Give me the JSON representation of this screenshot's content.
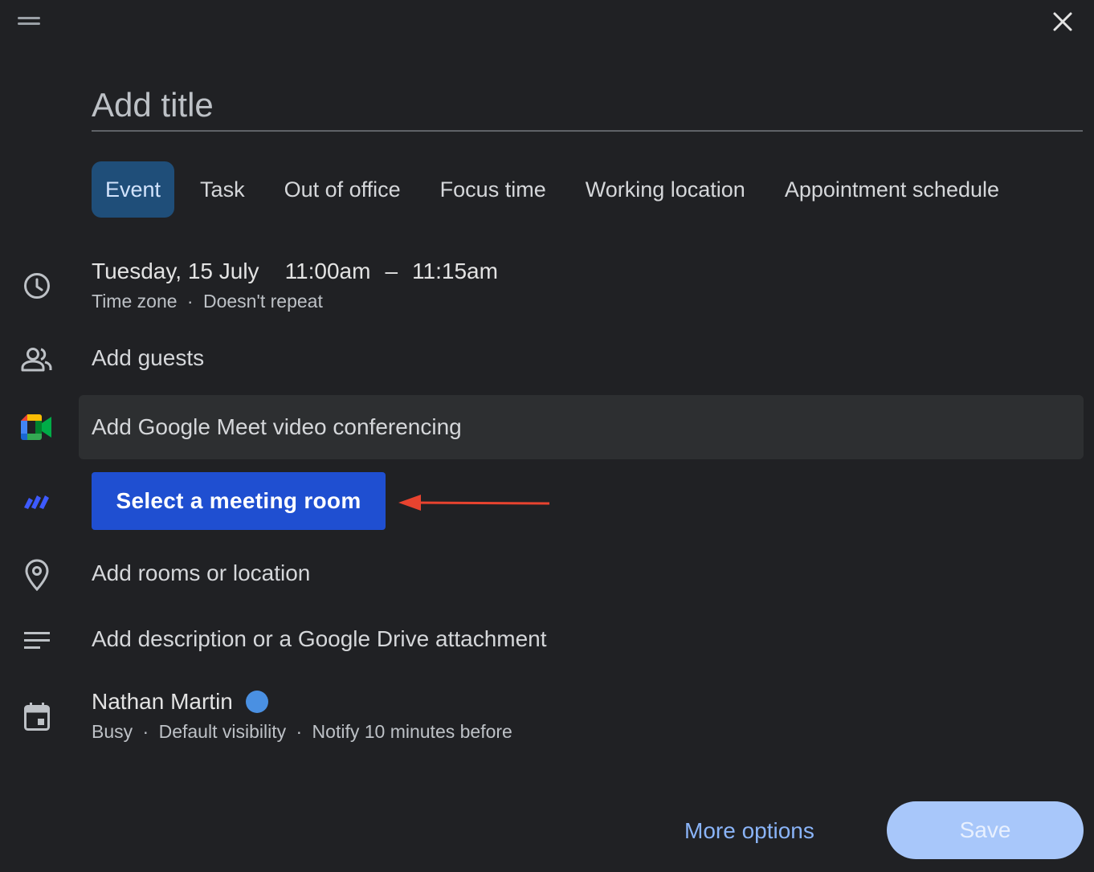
{
  "dialog": {
    "title_placeholder": "Add title",
    "tabs": [
      {
        "label": "Event",
        "active": true
      },
      {
        "label": "Task",
        "active": false
      },
      {
        "label": "Out of office",
        "active": false
      },
      {
        "label": "Focus time",
        "active": false
      },
      {
        "label": "Working location",
        "active": false
      },
      {
        "label": "Appointment schedule",
        "active": false
      }
    ],
    "datetime": {
      "date": "Tuesday, 15 July",
      "start": "11:00am",
      "separator": "–",
      "end": "11:15am",
      "timezone": "Time zone",
      "dot": "·",
      "repeat": "Doesn't repeat"
    },
    "guests_label": "Add guests",
    "meet_label": "Add Google Meet video conferencing",
    "room_button_label": "Select a meeting room",
    "location_label": "Add rooms or location",
    "description_label": "Add description or a Google Drive attachment",
    "calendar": {
      "owner": "Nathan Martin",
      "color": "#4a90e2",
      "status": "Busy",
      "visibility": "Default visibility",
      "notify": "Notify 10 minutes before",
      "dot": "·"
    },
    "more_options_label": "More options",
    "save_label": "Save"
  },
  "colors": {
    "background": "#202124",
    "active_tab": "#1f4e79",
    "room_button": "#1f4fd1",
    "save_button": "#a8c7fa",
    "link": "#8ab4f8",
    "annotation_arrow": "#e8432f"
  },
  "icons": [
    "drag-handle-icon",
    "close-icon",
    "clock-icon",
    "people-icon",
    "google-meet-icon",
    "meeting-room-app-icon",
    "location-pin-icon",
    "description-icon",
    "calendar-icon"
  ]
}
